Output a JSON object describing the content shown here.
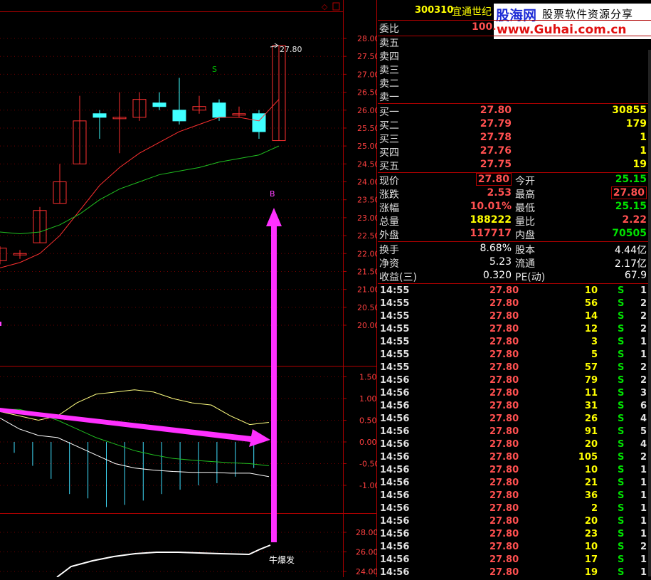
{
  "header": {
    "code": "300310",
    "name": "宜通世纪"
  },
  "watermark": {
    "site": "股海网",
    "tagline": "股票软件资源分享",
    "url": "www.Guhai.com.cn"
  },
  "weibi": {
    "label": "委比",
    "value": "100."
  },
  "sell_orders": [
    {
      "label": "卖五"
    },
    {
      "label": "卖四"
    },
    {
      "label": "卖三"
    },
    {
      "label": "卖二"
    },
    {
      "label": "卖一"
    }
  ],
  "buy_orders": [
    {
      "label": "买一",
      "price": "27.80",
      "volume": "30855"
    },
    {
      "label": "买二",
      "price": "27.79",
      "volume": "179"
    },
    {
      "label": "买三",
      "price": "27.78",
      "volume": "1"
    },
    {
      "label": "买四",
      "price": "27.76",
      "volume": "1"
    },
    {
      "label": "买五",
      "price": "27.75",
      "volume": "19"
    }
  ],
  "quote": [
    {
      "l1": "现价",
      "v1": "27.80",
      "l2": "今开",
      "v2": "25.15",
      "c1": "red",
      "c2": "grn"
    },
    {
      "l1": "涨跌",
      "v1": "2.53",
      "l2": "最高",
      "v2": "27.80",
      "c1": "red",
      "c2": "red"
    },
    {
      "l1": "涨幅",
      "v1": "10.01%",
      "l2": "最低",
      "v2": "25.15",
      "c1": "red",
      "c2": "grn"
    },
    {
      "l1": "总量",
      "v1": "188222",
      "l2": "量比",
      "v2": "2.22",
      "c1": "yel",
      "c2": "red"
    },
    {
      "l1": "外盘",
      "v1": "117717",
      "l2": "内盘",
      "v2": "70505",
      "c1": "red",
      "c2": "grn"
    }
  ],
  "fundamentals": [
    {
      "l1": "换手",
      "v1": "8.68%",
      "l2": "股本",
      "v2": "4.44亿"
    },
    {
      "l1": "净资",
      "v1": "5.23",
      "l2": "流通",
      "v2": "2.17亿"
    },
    {
      "l1": "收益(三)",
      "v1": "0.320",
      "l2": "PE(动)",
      "v2": "67.9"
    }
  ],
  "ticks": [
    {
      "time": "14:55",
      "price": "27.80",
      "vol": "10",
      "bs": "S",
      "n": "1"
    },
    {
      "time": "14:55",
      "price": "27.80",
      "vol": "56",
      "bs": "S",
      "n": "2"
    },
    {
      "time": "14:55",
      "price": "27.80",
      "vol": "14",
      "bs": "S",
      "n": "2"
    },
    {
      "time": "14:55",
      "price": "27.80",
      "vol": "12",
      "bs": "S",
      "n": "2"
    },
    {
      "time": "14:55",
      "price": "27.80",
      "vol": "3",
      "bs": "S",
      "n": "1"
    },
    {
      "time": "14:55",
      "price": "27.80",
      "vol": "5",
      "bs": "S",
      "n": "1"
    },
    {
      "time": "14:55",
      "price": "27.80",
      "vol": "57",
      "bs": "S",
      "n": "2"
    },
    {
      "time": "14:56",
      "price": "27.80",
      "vol": "79",
      "bs": "S",
      "n": "2"
    },
    {
      "time": "14:56",
      "price": "27.80",
      "vol": "11",
      "bs": "S",
      "n": "3"
    },
    {
      "time": "14:56",
      "price": "27.80",
      "vol": "31",
      "bs": "S",
      "n": "6"
    },
    {
      "time": "14:56",
      "price": "27.80",
      "vol": "26",
      "bs": "S",
      "n": "4"
    },
    {
      "time": "14:56",
      "price": "27.80",
      "vol": "91",
      "bs": "S",
      "n": "5"
    },
    {
      "time": "14:56",
      "price": "27.80",
      "vol": "20",
      "bs": "S",
      "n": "4"
    },
    {
      "time": "14:56",
      "price": "27.80",
      "vol": "105",
      "bs": "S",
      "n": "2"
    },
    {
      "time": "14:56",
      "price": "27.80",
      "vol": "10",
      "bs": "S",
      "n": "1"
    },
    {
      "time": "14:56",
      "price": "27.80",
      "vol": "21",
      "bs": "S",
      "n": "1"
    },
    {
      "time": "14:56",
      "price": "27.80",
      "vol": "36",
      "bs": "S",
      "n": "1"
    },
    {
      "time": "14:56",
      "price": "27.80",
      "vol": "2",
      "bs": "S",
      "n": "1"
    },
    {
      "time": "14:56",
      "price": "27.80",
      "vol": "20",
      "bs": "S",
      "n": "1"
    },
    {
      "time": "14:56",
      "price": "27.80",
      "vol": "23",
      "bs": "S",
      "n": "1"
    },
    {
      "time": "14:56",
      "price": "27.80",
      "vol": "10",
      "bs": "S",
      "n": "2"
    },
    {
      "time": "14:56",
      "price": "27.80",
      "vol": "17",
      "bs": "S",
      "n": "1"
    },
    {
      "time": "14:56",
      "price": "27.80",
      "vol": "19",
      "bs": "S",
      "n": "1"
    }
  ],
  "chart_data": {
    "type": "candlestick",
    "main": {
      "y_ticks": [
        "28.00",
        "27.50",
        "27.00",
        "26.50",
        "26.00",
        "25.50",
        "25.00",
        "24.50",
        "24.00",
        "23.50",
        "23.00",
        "22.50",
        "22.00",
        "21.50",
        "21.00",
        "20.50",
        "20.00"
      ],
      "last_price_label": "27.80",
      "signal_s": "S",
      "signal_b": "B",
      "ylim": [
        19.5,
        28.4
      ],
      "candles": [
        {
          "o": 21.8,
          "c": 22.15,
          "h": 22.2,
          "l": 21.7
        },
        {
          "o": 22.0,
          "c": 22.0,
          "h": 22.1,
          "l": 21.85
        },
        {
          "o": 22.3,
          "c": 23.2,
          "h": 23.3,
          "l": 22.3
        },
        {
          "o": 23.4,
          "c": 24.0,
          "h": 24.5,
          "l": 23.4
        },
        {
          "o": 24.5,
          "c": 25.7,
          "h": 26.4,
          "l": 24.5
        },
        {
          "o": 25.9,
          "c": 25.8,
          "h": 26.0,
          "l": 25.2
        },
        {
          "o": 25.8,
          "c": 25.8,
          "h": 26.5,
          "l": 24.8
        },
        {
          "o": 25.8,
          "c": 26.3,
          "h": 26.5,
          "l": 25.7
        },
        {
          "o": 26.2,
          "c": 26.1,
          "h": 26.5,
          "l": 26.0
        },
        {
          "o": 26.0,
          "c": 25.7,
          "h": 26.9,
          "l": 25.6
        },
        {
          "o": 26.0,
          "c": 26.1,
          "h": 26.4,
          "l": 25.9
        },
        {
          "o": 26.2,
          "c": 25.8,
          "h": 26.3,
          "l": 25.7
        },
        {
          "o": 25.9,
          "c": 25.9,
          "h": 26.1,
          "l": 25.8
        },
        {
          "o": 25.9,
          "c": 25.4,
          "h": 26.0,
          "l": 25.2
        },
        {
          "o": 25.15,
          "c": 27.8,
          "h": 27.8,
          "l": 25.15
        }
      ],
      "ma_red": [
        21.6,
        21.75,
        22.0,
        22.5,
        23.2,
        23.9,
        24.4,
        24.8,
        25.1,
        25.4,
        25.6,
        25.8,
        25.8,
        25.7,
        26.3
      ],
      "ma_green": [
        22.6,
        22.55,
        22.6,
        22.8,
        23.1,
        23.5,
        23.8,
        24.0,
        24.2,
        24.3,
        24.4,
        24.55,
        24.65,
        24.75,
        25.0
      ]
    },
    "macd": {
      "y_ticks": [
        "1.50",
        "1.00",
        "0.50",
        "0.00",
        "-0.50",
        "-1.00"
      ],
      "ylim": [
        -1.7,
        1.8
      ]
    },
    "sub": {
      "y_ticks": [
        "28.00",
        "26.00",
        "24.00"
      ],
      "label": "牛爆发"
    }
  }
}
